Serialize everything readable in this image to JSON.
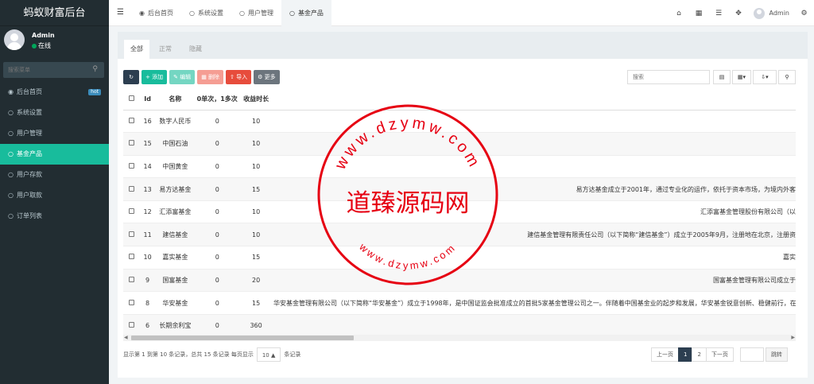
{
  "app": {
    "brand": "蚂蚁财富后台"
  },
  "user": {
    "name": "Admin",
    "status": "在线"
  },
  "sidebar": {
    "search_placeholder": "搜索菜单",
    "items": [
      {
        "label": "后台首页",
        "icon": "dashboard-icon",
        "badge": "hot"
      },
      {
        "label": "系统设置",
        "icon": "circle-icon"
      },
      {
        "label": "用户管理",
        "icon": "circle-icon"
      },
      {
        "label": "基金产品",
        "icon": "circle-icon",
        "active": true
      },
      {
        "label": "用户存款",
        "icon": "circle-icon"
      },
      {
        "label": "用户取款",
        "icon": "circle-icon"
      },
      {
        "label": "订单列表",
        "icon": "circle-icon"
      }
    ]
  },
  "topbar": {
    "tabs": [
      {
        "label": "后台首页",
        "icon": "dashboard-icon"
      },
      {
        "label": "系统设置",
        "icon": "circle-icon"
      },
      {
        "label": "用户管理",
        "icon": "circle-icon"
      },
      {
        "label": "基金产品",
        "icon": "circle-icon",
        "active": true
      }
    ],
    "user_name": "Admin"
  },
  "panel": {
    "tabs": [
      "全部",
      "正常",
      "隐藏"
    ],
    "toolbar": {
      "add": "添加",
      "edit": "编辑",
      "delete": "删除",
      "import": "导入",
      "more": "更多"
    },
    "search_placeholder": "搜索"
  },
  "table": {
    "columns": [
      "Id",
      "名称",
      "0单次，1多次",
      "收益时长"
    ],
    "rows": [
      {
        "id": "16",
        "name": "数字人民币",
        "type": "0",
        "duration": "10",
        "desc": ""
      },
      {
        "id": "15",
        "name": "中国石油",
        "type": "0",
        "duration": "10",
        "desc": ""
      },
      {
        "id": "14",
        "name": "中国黄金",
        "type": "0",
        "duration": "10",
        "desc": ""
      },
      {
        "id": "13",
        "name": "易方达基金",
        "type": "0",
        "duration": "15",
        "desc": "易方达基金成立于2001年，通过专业化的运作，依托于资本市场，为境内外客"
      },
      {
        "id": "12",
        "name": "汇添富基金",
        "type": "0",
        "duration": "10",
        "desc": "汇添富基金管理股份有限公司（以"
      },
      {
        "id": "11",
        "name": "建信基金",
        "type": "0",
        "duration": "10",
        "desc": "建信基金管理有限责任公司（以下简称“建信基金”）成立于2005年9月，注册地在北京，注册资"
      },
      {
        "id": "10",
        "name": "嘉实基金",
        "type": "0",
        "duration": "15",
        "desc": "嘉实"
      },
      {
        "id": "9",
        "name": "国富基金",
        "type": "0",
        "duration": "20",
        "desc": "国富基金管理有限公司成立于"
      },
      {
        "id": "8",
        "name": "华安基金",
        "type": "0",
        "duration": "15",
        "desc": "华安基金管理有限公司（以下简称“华安基金”）成立于1998年，是中国证监会批准成立的首批5家基金管理公司之一。伴随着中国基金业的起步和发展，华安基金锐意创新、稳健前行，在公司"
      },
      {
        "id": "6",
        "name": "长期余利宝",
        "type": "0",
        "duration": "360",
        "desc": ""
      }
    ]
  },
  "pagination": {
    "info_prefix": "显示第 1 到第 10 条记录，总共 15 条记录 每页显示",
    "page_size": "10",
    "info_suffix": "条记录",
    "prev": "上一页",
    "pages": [
      "1",
      "2"
    ],
    "next": "下一页",
    "jump": "跳转"
  },
  "watermark": {
    "main": "道臻源码网",
    "top_arc": "www.dzymw.com",
    "bottom_arc": "www.dzymw.com"
  },
  "colors": {
    "sidebar_bg": "#222d32",
    "active_green": "#18bc9c",
    "primary_dark": "#2c3e50",
    "danger": "#e74c3c",
    "stamp_red": "#e60012"
  }
}
